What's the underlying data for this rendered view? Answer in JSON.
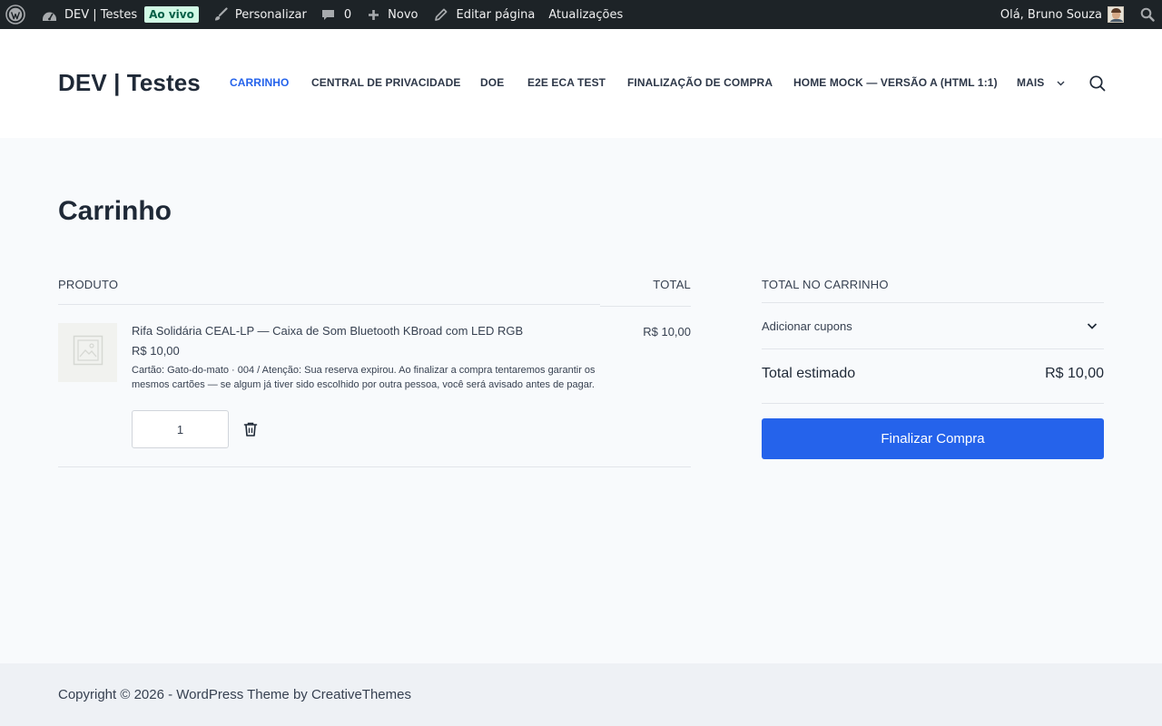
{
  "admin_bar": {
    "wp_logo_icon": "wordpress-logo-icon",
    "site_name": "DEV | Testes",
    "live_badge": "Ao vivo",
    "customize": "Personalizar",
    "comments_count": "0",
    "new": "Novo",
    "edit_page": "Editar página",
    "updates": "Atualizações",
    "greeting": "Olá, Bruno Souza"
  },
  "header": {
    "site_title": "DEV | Testes",
    "nav": {
      "cart": "CARRINHO",
      "privacy": "CENTRAL DE PRIVACIDADE",
      "donate": "DOE",
      "e2e": "E2E ECA TEST",
      "checkout": "FINALIZAÇÃO DE COMPRA",
      "home_mock": "HOME MOCK — VERSÃO A (HTML 1:1)",
      "more": "MAIS"
    },
    "active_item": "CARRINHO"
  },
  "main": {
    "page_title": "Carrinho",
    "table": {
      "col_product": "PRODUTO",
      "col_total": "TOTAL",
      "items": [
        {
          "name": "Rifa Solidária CEAL-LP — Caixa de Som Bluetooth KBroad com LED RGB",
          "price": "R$ 10,00",
          "meta": "Cartão: Gato-do-mato · 004 / Atenção: Sua reserva expirou. Ao finalizar a compra tentaremos garantir os mesmos cartões — se algum já tiver sido escolhido por outra pessoa, você será avisado antes de pagar.",
          "quantity": "1",
          "total": "R$ 10,00"
        }
      ]
    }
  },
  "cart_totals": {
    "title": "TOTAL NO CARRINHO",
    "coupon_label": "Adicionar cupons",
    "estimated_label": "Total estimado",
    "estimated_value": "R$ 10,00",
    "checkout_button": "Finalizar Compra"
  },
  "footer": {
    "text": "Copyright © 2026 - WordPress Theme by CreativeThemes"
  },
  "colors": {
    "accent": "#2563eb",
    "admin_bar": "#1d2327",
    "live_badge_bg": "#d1fae5"
  }
}
